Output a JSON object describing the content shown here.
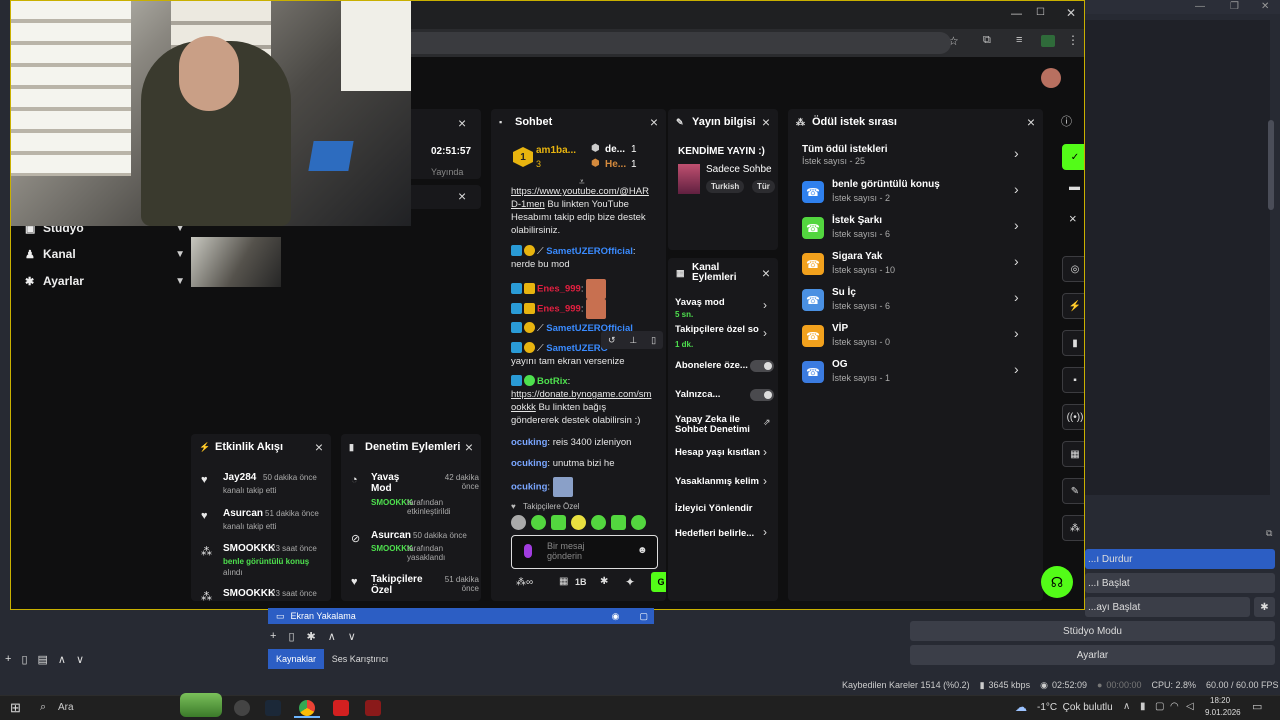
{
  "browser": {
    "window_controls": [
      "—",
      "☐",
      "✕"
    ]
  },
  "left_nav": [
    {
      "label": "Stüdyo",
      "icon": "video-icon"
    },
    {
      "label": "Kanal",
      "icon": "channel-icon"
    },
    {
      "label": "Ayarlar",
      "icon": "gear-icon"
    }
  ],
  "stream_panel": {
    "time": "02:51:57",
    "status": "Yayında"
  },
  "activity": {
    "title": "Etkinlik Akışı",
    "items": [
      {
        "name": "Jay284",
        "time": "50 dakika önce",
        "desc": "kanalı takip etti"
      },
      {
        "name": "Asurcan",
        "time": "51 dakika önce",
        "desc": "kanalı takip etti"
      },
      {
        "name": "SMOOKKK",
        "time": "23 saat önce",
        "desc": "benle görüntülü konuş",
        "desc2": "alındı"
      },
      {
        "name": "SMOOKKK",
        "time": "23 saat önce",
        "desc": ""
      }
    ]
  },
  "moderation": {
    "title": "Denetim Eylemleri",
    "items": [
      {
        "name": "Yavaş Mod",
        "time": "42 dakika önce",
        "actor": "SMOOKKK",
        "desc": "tarafından etkinleştirildi"
      },
      {
        "name": "Asurcan",
        "time": "50 dakika önce",
        "actor": "SMOOKKK",
        "desc": "tarafından yasaklandı"
      },
      {
        "name": "Takipçilere Özel",
        "time": "51 dakika önce",
        "actor": "",
        "desc": ""
      }
    ]
  },
  "chat": {
    "title": "Sohbet",
    "top1": {
      "name": "am1ba...",
      "count": "3"
    },
    "top2": {
      "name": "de...",
      "count": "1"
    },
    "top3": {
      "name": "He...",
      "count": "1"
    },
    "rank1": "1",
    "messages": [
      {
        "user": "",
        "text": "https://www.youtube.com/@HAR D-1men",
        "text2": " Bu linkten YouTube Hesabımı takip edip bize destek olabilirsiniz."
      },
      {
        "user": "SametUZEROfficial",
        "text": "nerde bu mod"
      },
      {
        "user": "Enes_999",
        "text": ""
      },
      {
        "user": "Enes_999",
        "text": ""
      },
      {
        "user": "SametUZEROfficial",
        "text": ""
      },
      {
        "user": "SametUZERO",
        "text": "yayını tam ekran versenize"
      },
      {
        "user": "BotRix",
        "text": "https://donate.bynogame.com/sm ookkk",
        "text2": " Bu linkten bağış göndererek destek olabilirsin :)"
      },
      {
        "user": "ocuking",
        "text": "reis 3400 izleniyon"
      },
      {
        "user": "ocuking",
        "text": "unutma bizi he"
      },
      {
        "user": "ocuking",
        "text": ""
      }
    ],
    "followers_only": "Takipçilere Özel",
    "input_placeholder": "Bir mesaj gönderin",
    "gift_count": "1B",
    "send_label": "G"
  },
  "stream_info": {
    "title": "Yayın bilgisi",
    "stream_title": "KENDİME YAYIN :)",
    "category": "Sadece Sohbe",
    "tags": [
      "Turkish",
      "Tür"
    ]
  },
  "channel_actions": {
    "title": "Kanal Eylemleri",
    "items": [
      {
        "label": "Yavaş mod",
        "value": "5 sn.",
        "kind": "chevron"
      },
      {
        "label": "Takipçilere özel so",
        "value": "1 dk.",
        "kind": "chevron"
      },
      {
        "label": "Abonelere öze...",
        "value": "",
        "kind": "toggle"
      },
      {
        "label": "Yalnızca...",
        "value": "",
        "kind": "toggle"
      },
      {
        "label": "Yapay Zeka ile Sohbet Denetimi",
        "value": "",
        "kind": "external"
      },
      {
        "label": "Hesap yaşı kısıtlan",
        "value": "",
        "kind": "chevron"
      },
      {
        "label": "Yasaklanmış kelim",
        "value": "",
        "kind": "chevron"
      },
      {
        "label": "İzleyici Yönlendir",
        "value": "",
        "kind": "none"
      },
      {
        "label": "Hedefleri belirle...",
        "value": "",
        "kind": "chevron"
      }
    ]
  },
  "rewards": {
    "title": "Ödül istek sırası",
    "all_label": "Tüm ödül istekleri",
    "all_count": "İstek sayısı - 25",
    "items": [
      {
        "label": "benle görüntülü konuş",
        "count": "İstek sayısı - 2",
        "color": "#2f80ed"
      },
      {
        "label": "İstek Şarkı",
        "count": "İstek sayısı - 6",
        "color": "#53d63f"
      },
      {
        "label": "Sigara Yak",
        "count": "İstek sayısı - 10",
        "color": "#f2a11d"
      },
      {
        "label": "Su İç",
        "count": "İstek sayısı - 6",
        "color": "#4a90e2"
      },
      {
        "label": "VİP",
        "count": "İstek sayısı - 0",
        "color": "#f2a11d"
      },
      {
        "label": "OG",
        "count": "İstek sayısı - 1",
        "color": "#3b7be0"
      }
    ]
  },
  "obs": {
    "source": "Ekran Yakalama",
    "tabs": [
      "Kaynaklar",
      "Ses Karıştırıcı"
    ],
    "controls": [
      "...ı Durdur",
      "...ı Başlat",
      "...ayı Başlat",
      "Stüdyo Modu",
      "Ayarlar"
    ],
    "status": {
      "dropped": "Kaybedilen Kareler 1514 (%0.2)",
      "bitrate": "3645 kbps",
      "live_time": "02:52:09",
      "rec_time": "00:00:00",
      "cpu": "CPU: 2.8%",
      "fps": "60.00 / 60.00 FPS"
    }
  },
  "taskbar": {
    "search": "Ara",
    "weather": "-1°C  Çok bulutlu",
    "time": "18:20",
    "date": "9.01.2026"
  }
}
